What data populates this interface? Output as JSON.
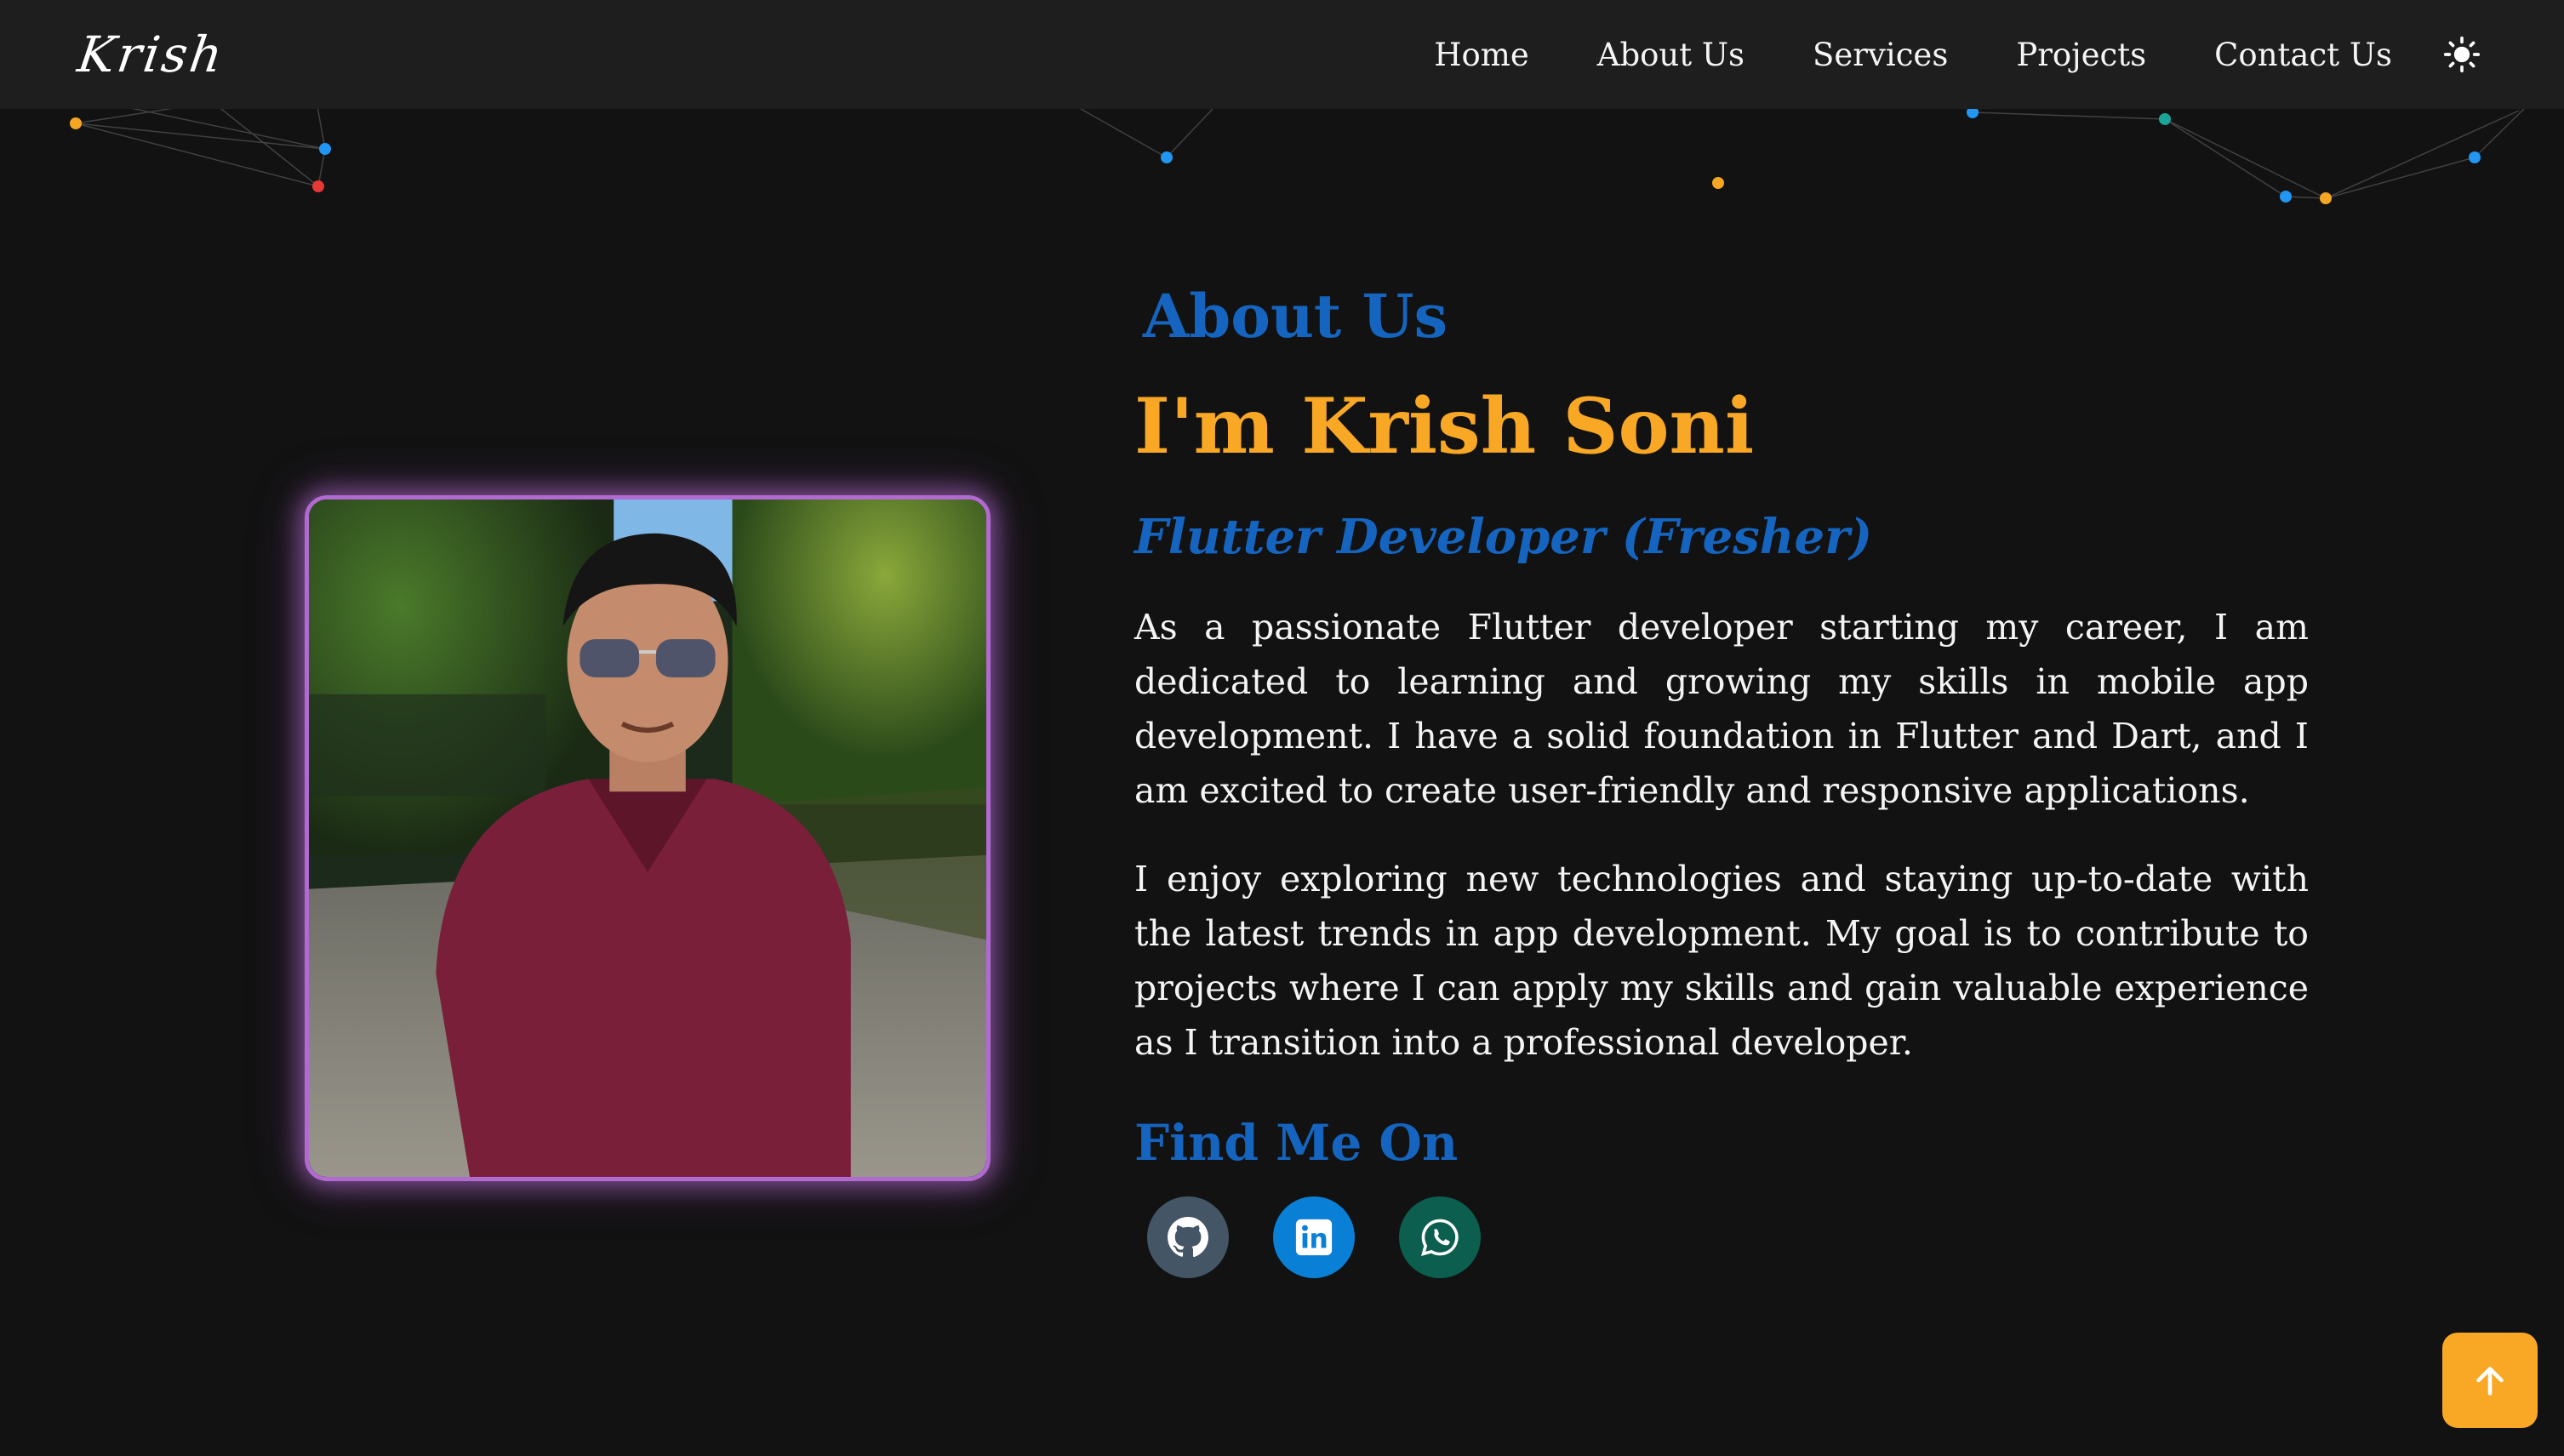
{
  "navbar": {
    "logo": "Krish",
    "links": [
      "Home",
      "About Us",
      "Services",
      "Projects",
      "Contact Us"
    ],
    "theme_icon": "sun-icon"
  },
  "about": {
    "section_title": "About Us",
    "greeting": "I'm Krish Soni",
    "role": "Flutter Developer (Fresher)",
    "paragraphs": [
      "As a passionate Flutter developer starting my career, I am dedicated to learning and growing my skills in mobile app development. I have a solid foundation in Flutter and Dart, and I am excited to create user-friendly and responsive applications.",
      "I enjoy exploring new technologies and staying up-to-date with the latest trends in app development. My goal is to contribute to projects where I can apply my skills and gain valuable experience as I transition into a professional developer."
    ],
    "find_me_title": "Find Me On",
    "socials": [
      "github-icon",
      "linkedin-icon",
      "whatsapp-icon"
    ]
  },
  "scroll_top_icon": "arrow-up-icon",
  "colors": {
    "background": "#121212",
    "navbar": "#1e1e1e",
    "accent_blue": "#1565c0",
    "accent_orange": "#f9a826",
    "frame_glow": "#b16bd0"
  }
}
